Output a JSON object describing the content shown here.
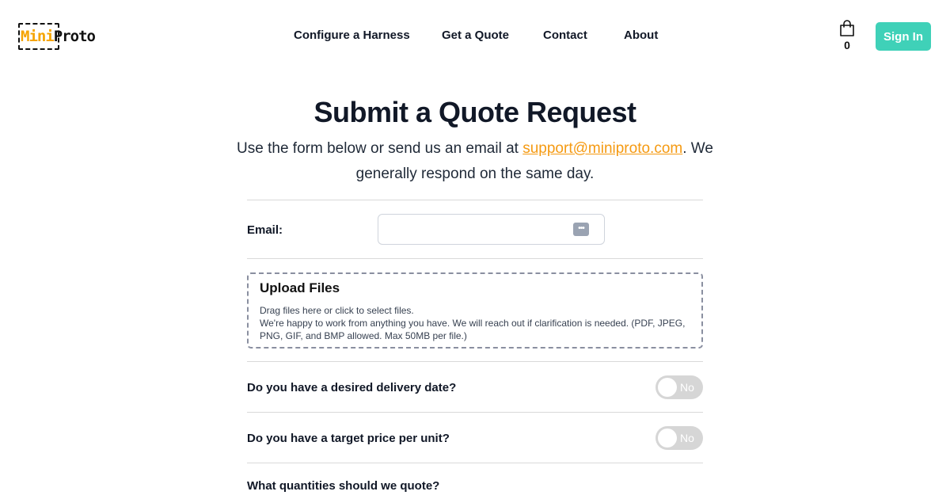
{
  "brand": {
    "logo_part1": "Mini",
    "logo_part2": "Proto",
    "accent_color": "#f5a400"
  },
  "nav": {
    "items": [
      {
        "label": "Configure a Harness"
      },
      {
        "label": "Get a Quote"
      },
      {
        "label": "Contact"
      },
      {
        "label": "About"
      }
    ]
  },
  "cart": {
    "icon": "shopping-bag-icon",
    "count": "0"
  },
  "signin": {
    "label": "Sign In",
    "color": "#3fd1b8"
  },
  "page": {
    "title": "Submit a Quote Request",
    "subtitle_before": "Use the form below or send us an email at ",
    "support_email": "support@miniproto.com",
    "subtitle_after": ". We generally respond on the same day.",
    "link_color": "#f59a12"
  },
  "form": {
    "email_label": "Email:",
    "email_value": "",
    "password_manager_icon": "more-dots-icon",
    "upload": {
      "title": "Upload Files",
      "line1": "Drag files here or click to select files.",
      "line2": "We're happy to work from anything you have. We will reach out if clarification is needed. (PDF, JPEG, PNG, GIF, and BMP allowed. Max 50MB per file.)"
    },
    "delivery_question": "Do you have a desired delivery date?",
    "delivery_toggle": "No",
    "price_question": "Do you have a target price per unit?",
    "price_toggle": "No",
    "quantities_question": "What quantities should we quote?"
  }
}
